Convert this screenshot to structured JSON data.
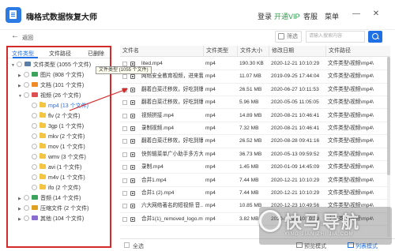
{
  "app": {
    "title": "嗨格式数据恢复大师",
    "menu": {
      "login": "登录",
      "vip": "开通VIP",
      "service": "客服",
      "menu": "菜单"
    },
    "window_controls": {
      "minimize": "—",
      "close": "✕"
    }
  },
  "toolbar": {
    "back_label": "返回",
    "filter_label": "筛选",
    "search_placeholder": "请输入搜索内容"
  },
  "left_panel": {
    "tabs": [
      {
        "label": "文件类型",
        "active": true
      },
      {
        "label": "文件路径",
        "active": false
      },
      {
        "label": "已删除",
        "active": false
      }
    ],
    "tooltip": "文件类型 (1055 个文件)",
    "tree": [
      {
        "label": "文件类型 (1055 个文件)",
        "icon": "computer-icon",
        "level": 0,
        "expanded": true
      },
      {
        "label": "图片 (808 个文件)",
        "icon": "image-folder-icon",
        "level": 1,
        "expanded": false
      },
      {
        "label": "文档 (101 个文件)",
        "icon": "document-folder-icon",
        "level": 1,
        "expanded": false
      },
      {
        "label": "视频 (26 个文件)",
        "icon": "video-folder-icon",
        "level": 1,
        "expanded": true
      },
      {
        "label": "mp4 (13 个文件)",
        "icon": "folder-icon",
        "level": 2,
        "selected": true
      },
      {
        "label": "flv (2 个文件)",
        "icon": "folder-icon",
        "level": 2
      },
      {
        "label": "3gp (1 个文件)",
        "icon": "folder-icon",
        "level": 2
      },
      {
        "label": "mkv (2 个文件)",
        "icon": "folder-icon",
        "level": 2
      },
      {
        "label": "mov (1 个文件)",
        "icon": "folder-icon",
        "level": 2
      },
      {
        "label": "wmv (3 个文件)",
        "icon": "folder-icon",
        "level": 2
      },
      {
        "label": "avi (1 个文件)",
        "icon": "folder-icon",
        "level": 2
      },
      {
        "label": "m4v (1 个文件)",
        "icon": "folder-icon",
        "level": 2
      },
      {
        "label": "ifo (2 个文件)",
        "icon": "folder-icon",
        "level": 2
      },
      {
        "label": "音频 (14 个文件)",
        "icon": "audio-folder-icon",
        "level": 1,
        "expanded": false
      },
      {
        "label": "压缩文件 (2 个文件)",
        "icon": "archive-folder-icon",
        "level": 1,
        "expanded": false
      },
      {
        "label": "其他 (104 个文件)",
        "icon": "other-folder-icon",
        "level": 1,
        "expanded": false
      }
    ]
  },
  "table": {
    "columns": [
      "文件名",
      "文件类型",
      "文件大小",
      "修改日期",
      "文件路径"
    ],
    "rows": [
      {
        "name": "lited.mp4",
        "type": "mp4",
        "size": "190.30 KB",
        "date": "2020-12-21 10:10:29",
        "path": "文件类型\\视频\\mp4\\"
      },
      {
        "name": "网络安全教育视频，进来我...",
        "type": "mp4",
        "size": "11.07 MB",
        "date": "2019-09-25 17:44:04",
        "path": "文件类型\\视频\\mp4\\"
      },
      {
        "name": "翻着白菜迁移效，好吃到爆...",
        "type": "mp4",
        "size": "26.51 MB",
        "date": "2020-06-27 10:11:53",
        "path": "文件类型\\视频\\mp4\\"
      },
      {
        "name": "翻着白菜迁移效，好吃到爆...",
        "type": "mp4",
        "size": "5.96 MB",
        "date": "2020-05-05 11:05:05",
        "path": "文件类型\\视频\\mp4\\"
      },
      {
        "name": "视频拼接.mp4",
        "type": "mp4",
        "size": "14.89 MB",
        "date": "2020-08-21 10:46:41",
        "path": "文件类型\\视频\\mp4\\"
      },
      {
        "name": "录制视频.mp4",
        "type": "mp4",
        "size": "7.32 MB",
        "date": "2020-08-21 10:46:41",
        "path": "文件类型\\视频\\mp4\\"
      },
      {
        "name": "翻着白菜迁移效，好吃到爆...",
        "type": "mp4",
        "size": "26.52 MB",
        "date": "2020-08-28 09:41:16",
        "path": "文件类型\\视频\\mp4\\"
      },
      {
        "name": "快剪辑菜单广小助手多方大...",
        "type": "mp4",
        "size": "36.73 MB",
        "date": "2020-05-13 09:59:52",
        "path": "文件类型\\视频\\mp4\\"
      },
      {
        "name": "录制.mp4",
        "type": "mp4",
        "size": "1.45 MB",
        "date": "2020-01-09 14:45:09",
        "path": "文件类型\\视频\\mp4\\"
      },
      {
        "name": "合并1.mp4",
        "type": "mp4",
        "size": "7.44 MB",
        "date": "2020-12-21 10:10:29",
        "path": "文件类型\\视频\\mp4\\"
      },
      {
        "name": "合并1 (2).mp4",
        "type": "mp4",
        "size": "7.44 MB",
        "date": "2020-12-21 10:10:29",
        "path": "文件类型\\视频\\mp4\\"
      },
      {
        "name": "六大网络著名的短视频 音...",
        "type": "mp4",
        "size": "10.85 MB",
        "date": "2020-12-23 10:49:56",
        "path": "文件类型\\视频\\mp4\\"
      },
      {
        "name": "合并1(1)_removed_logo.m...",
        "type": "mp4",
        "size": "3.82 MB",
        "date": "2020-12-21 10:10:29",
        "path": "文件类型\\视频\\mp4\\"
      }
    ]
  },
  "bottom": {
    "select_all": "全选",
    "preview_mode": "预览模式",
    "list_mode": "列表模式"
  },
  "watermark": {
    "main": "快马导航",
    "sub": "YING JIAN ZHI JIA.COM"
  },
  "colors": {
    "accent": "#1f6fe5",
    "highlight_border": "#d42a2a",
    "vip": "#2c9f4b"
  }
}
